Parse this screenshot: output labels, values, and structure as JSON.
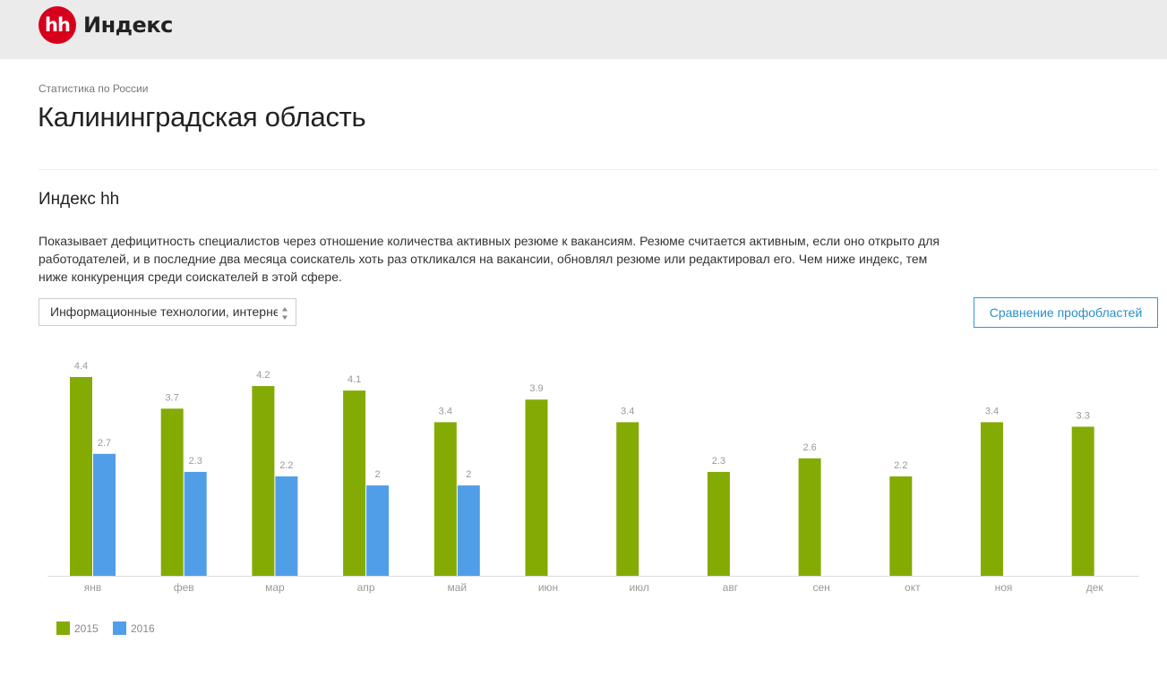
{
  "header": {
    "logo_text": "hh",
    "brand": "Индекс"
  },
  "breadcrumb": "Статистика по России",
  "page_title": "Калининградская область",
  "section": {
    "title": "Индекс hh",
    "description": "Показывает дефицитность специалистов через отношение количества активных резюме к вакансиям. Резюме считается активным, если оно открыто для работодателей, и в последние два месяца соискатель хоть раз откликался на вакансии, обновлял резюме или редактировал его. Чем ниже индекс, тем ниже конкуренция среди соискателей в этой сфере."
  },
  "filter": {
    "selected": "Информационные технологии, интернет, телеком"
  },
  "compare_button": "Сравнение профобластей",
  "icons": {
    "select_arrows": "up-down-arrows-icon"
  },
  "colors": {
    "series_2015": "#84ab04",
    "series_2016": "#519ee8",
    "accent": "#2b9bd3",
    "logo": "#d6001c"
  },
  "chart_data": {
    "type": "bar",
    "categories": [
      "янв",
      "фев",
      "мар",
      "апр",
      "май",
      "июн",
      "июл",
      "авг",
      "сен",
      "окт",
      "ноя",
      "дек"
    ],
    "series": [
      {
        "name": "2015",
        "color": "#84ab04",
        "values": [
          4.4,
          3.7,
          4.2,
          4.1,
          3.4,
          3.9,
          3.4,
          2.3,
          2.6,
          2.2,
          3.4,
          3.3
        ]
      },
      {
        "name": "2016",
        "color": "#519ee8",
        "values": [
          2.7,
          2.3,
          2.2,
          2,
          2,
          null,
          null,
          null,
          null,
          null,
          null,
          null
        ]
      }
    ],
    "ylim": [
      0,
      4.4
    ],
    "grid": false,
    "legend": "bottom-left",
    "data_labels": true
  }
}
